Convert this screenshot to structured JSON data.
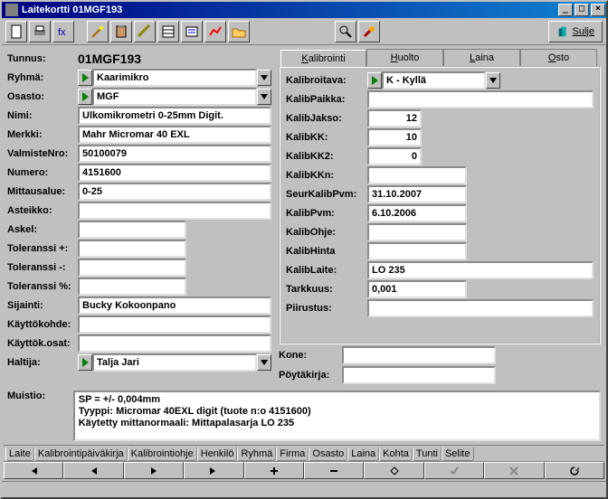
{
  "window": {
    "title": "Laitekortti 01MGF193"
  },
  "toolbar": {
    "close": "Sulje"
  },
  "left": {
    "tunnus_lab": "Tunnus:",
    "tunnus": "01MGF193",
    "ryhma_lab": "Ryhmä:",
    "ryhma": "Kaarimikro",
    "osasto_lab": "Osasto:",
    "osasto": "MGF",
    "nimi_lab": "Nimi:",
    "nimi": "Ulkomikrometri 0-25mm Digit.",
    "merkki_lab": "Merkki:",
    "merkki": "Mahr Micromar 40 EXL",
    "valmistenro_lab": "ValmisteNro:",
    "valmistenro": "50100079",
    "numero_lab": "Numero:",
    "numero": "4151600",
    "mittausalue_lab": "Mittausalue:",
    "mittausalue": "0-25",
    "asteikko_lab": "Asteikko:",
    "asteikko": "",
    "askel_lab": "Askel:",
    "askel": "",
    "tolpos_lab": "Toleranssi +:",
    "tolpos": "",
    "tolneg_lab": "Toleranssi -:",
    "tolneg": "",
    "tolpct_lab": "Toleranssi %:",
    "tolpct": "",
    "sijainti_lab": "Sijainti:",
    "sijainti": "Bucky Kokoonpano",
    "kayttokohde_lab": "Käyttökohde:",
    "kayttokohde": "",
    "kayttokosat_lab": "Käyttök.osat:",
    "kayttokosat": "",
    "haltija_lab": "Haltija:",
    "haltija": "Talja Jari",
    "muistio_lab": "Muistio:",
    "muistio": "SP = +/- 0,004mm\nTyyppi: Micromar 40EXL digit (tuote n:o 4151600)\nKäytetty mittanormaali: Mittapalasarja LO 235"
  },
  "tabs": {
    "kalibrointi": "Kalibrointi",
    "huolto": "Huolto",
    "laina": "Laina",
    "osto": "Osto"
  },
  "right": {
    "kalibroitava_lab": "Kalibroitava:",
    "kalibroitava": "K - Kyllä",
    "kalibpaikka_lab": "KalibPaikka:",
    "kalibpaikka": "",
    "kalibjakso_lab": "KalibJakso:",
    "kalibjakso": "12",
    "kalibkk_lab": "KalibKK:",
    "kalibkk": "10",
    "kalibkk2_lab": "KalibKK2:",
    "kalibkk2": "0",
    "kalibkkn_lab": "KalibKKn:",
    "kalibkkn": "",
    "seurkalibpvm_lab": "SeurKalibPvm:",
    "seurkalibpvm": "31.10.2007",
    "kalibpvm_lab": "KalibPvm:",
    "kalibpvm": "6.10.2006",
    "kalibohje_lab": "KalibOhje:",
    "kalibohje": "",
    "kalibhinta_lab": "KalibHinta",
    "kalibhinta": "",
    "kaliblaite_lab": "KalibLaite:",
    "kaliblaite": "LO 235",
    "tarkkuus_lab": "Tarkkuus:",
    "tarkkuus": "0,001",
    "piirustus_lab": "Piirustus:",
    "piirustus": "",
    "kone_lab": "Kone:",
    "kone": "",
    "poytakirja_lab": "Pöytäkirja:",
    "poytakirja": ""
  },
  "btabs": [
    "Laite",
    "Kalibrointipäiväkirja",
    "Kalibrointiohje",
    "Henkilö",
    "Ryhmä",
    "Firma",
    "Osasto",
    "Laina",
    "Kohta",
    "Tunti",
    "Selite"
  ]
}
